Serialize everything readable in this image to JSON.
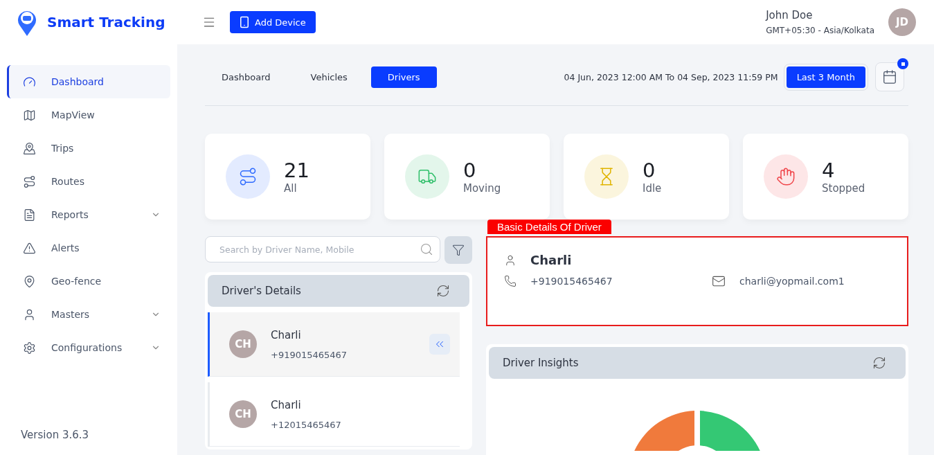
{
  "brand": {
    "name": "Smart Tracking"
  },
  "header": {
    "add_button": "Add Device",
    "user_name": "John Doe",
    "timezone": "GMT+05:30 - Asia/Kolkata",
    "avatar_initials": "JD"
  },
  "sidebar": {
    "items": [
      {
        "label": "Dashboard",
        "selected": true,
        "expandable": false
      },
      {
        "label": "MapView",
        "selected": false,
        "expandable": false
      },
      {
        "label": "Trips",
        "selected": false,
        "expandable": false
      },
      {
        "label": "Routes",
        "selected": false,
        "expandable": false
      },
      {
        "label": "Reports",
        "selected": false,
        "expandable": true
      },
      {
        "label": "Alerts",
        "selected": false,
        "expandable": false
      },
      {
        "label": "Geo-fence",
        "selected": false,
        "expandable": false
      },
      {
        "label": "Masters",
        "selected": false,
        "expandable": true
      },
      {
        "label": "Configurations",
        "selected": false,
        "expandable": true
      }
    ],
    "version": "Version 3.6.3"
  },
  "tabs": [
    {
      "label": "Dashboard",
      "selected": false
    },
    {
      "label": "Vehicles",
      "selected": false
    },
    {
      "label": "Drivers",
      "selected": true
    }
  ],
  "date_range": "04 Jun, 2023 12:00 AM To 04 Sep, 2023 11:59 PM",
  "range_button": "Last 3 Month",
  "calendar_badge": true,
  "stats": [
    {
      "value": "21",
      "label": "All",
      "color": "#2f6bff"
    },
    {
      "value": "0",
      "label": "Moving",
      "color": "#2fbf6a"
    },
    {
      "value": "0",
      "label": "Idle",
      "color": "#e0b400"
    },
    {
      "value": "4",
      "label": "Stopped",
      "color": "#f0454a"
    }
  ],
  "search": {
    "placeholder": "Search by Driver Name, Mobile"
  },
  "drivers_panel": {
    "title": "Driver's Details",
    "drivers": [
      {
        "initials": "CH",
        "name": "Charli",
        "phone": "+919015465467",
        "selected": true
      },
      {
        "initials": "CH",
        "name": "Charli",
        "phone": "+12015465467",
        "selected": false
      }
    ]
  },
  "basic_details": {
    "tag": "Basic Details Of Driver",
    "name": "Charli",
    "phone": "+919015465467",
    "email": "charli@yopmail.com1"
  },
  "insights": {
    "title": "Driver Insights"
  }
}
